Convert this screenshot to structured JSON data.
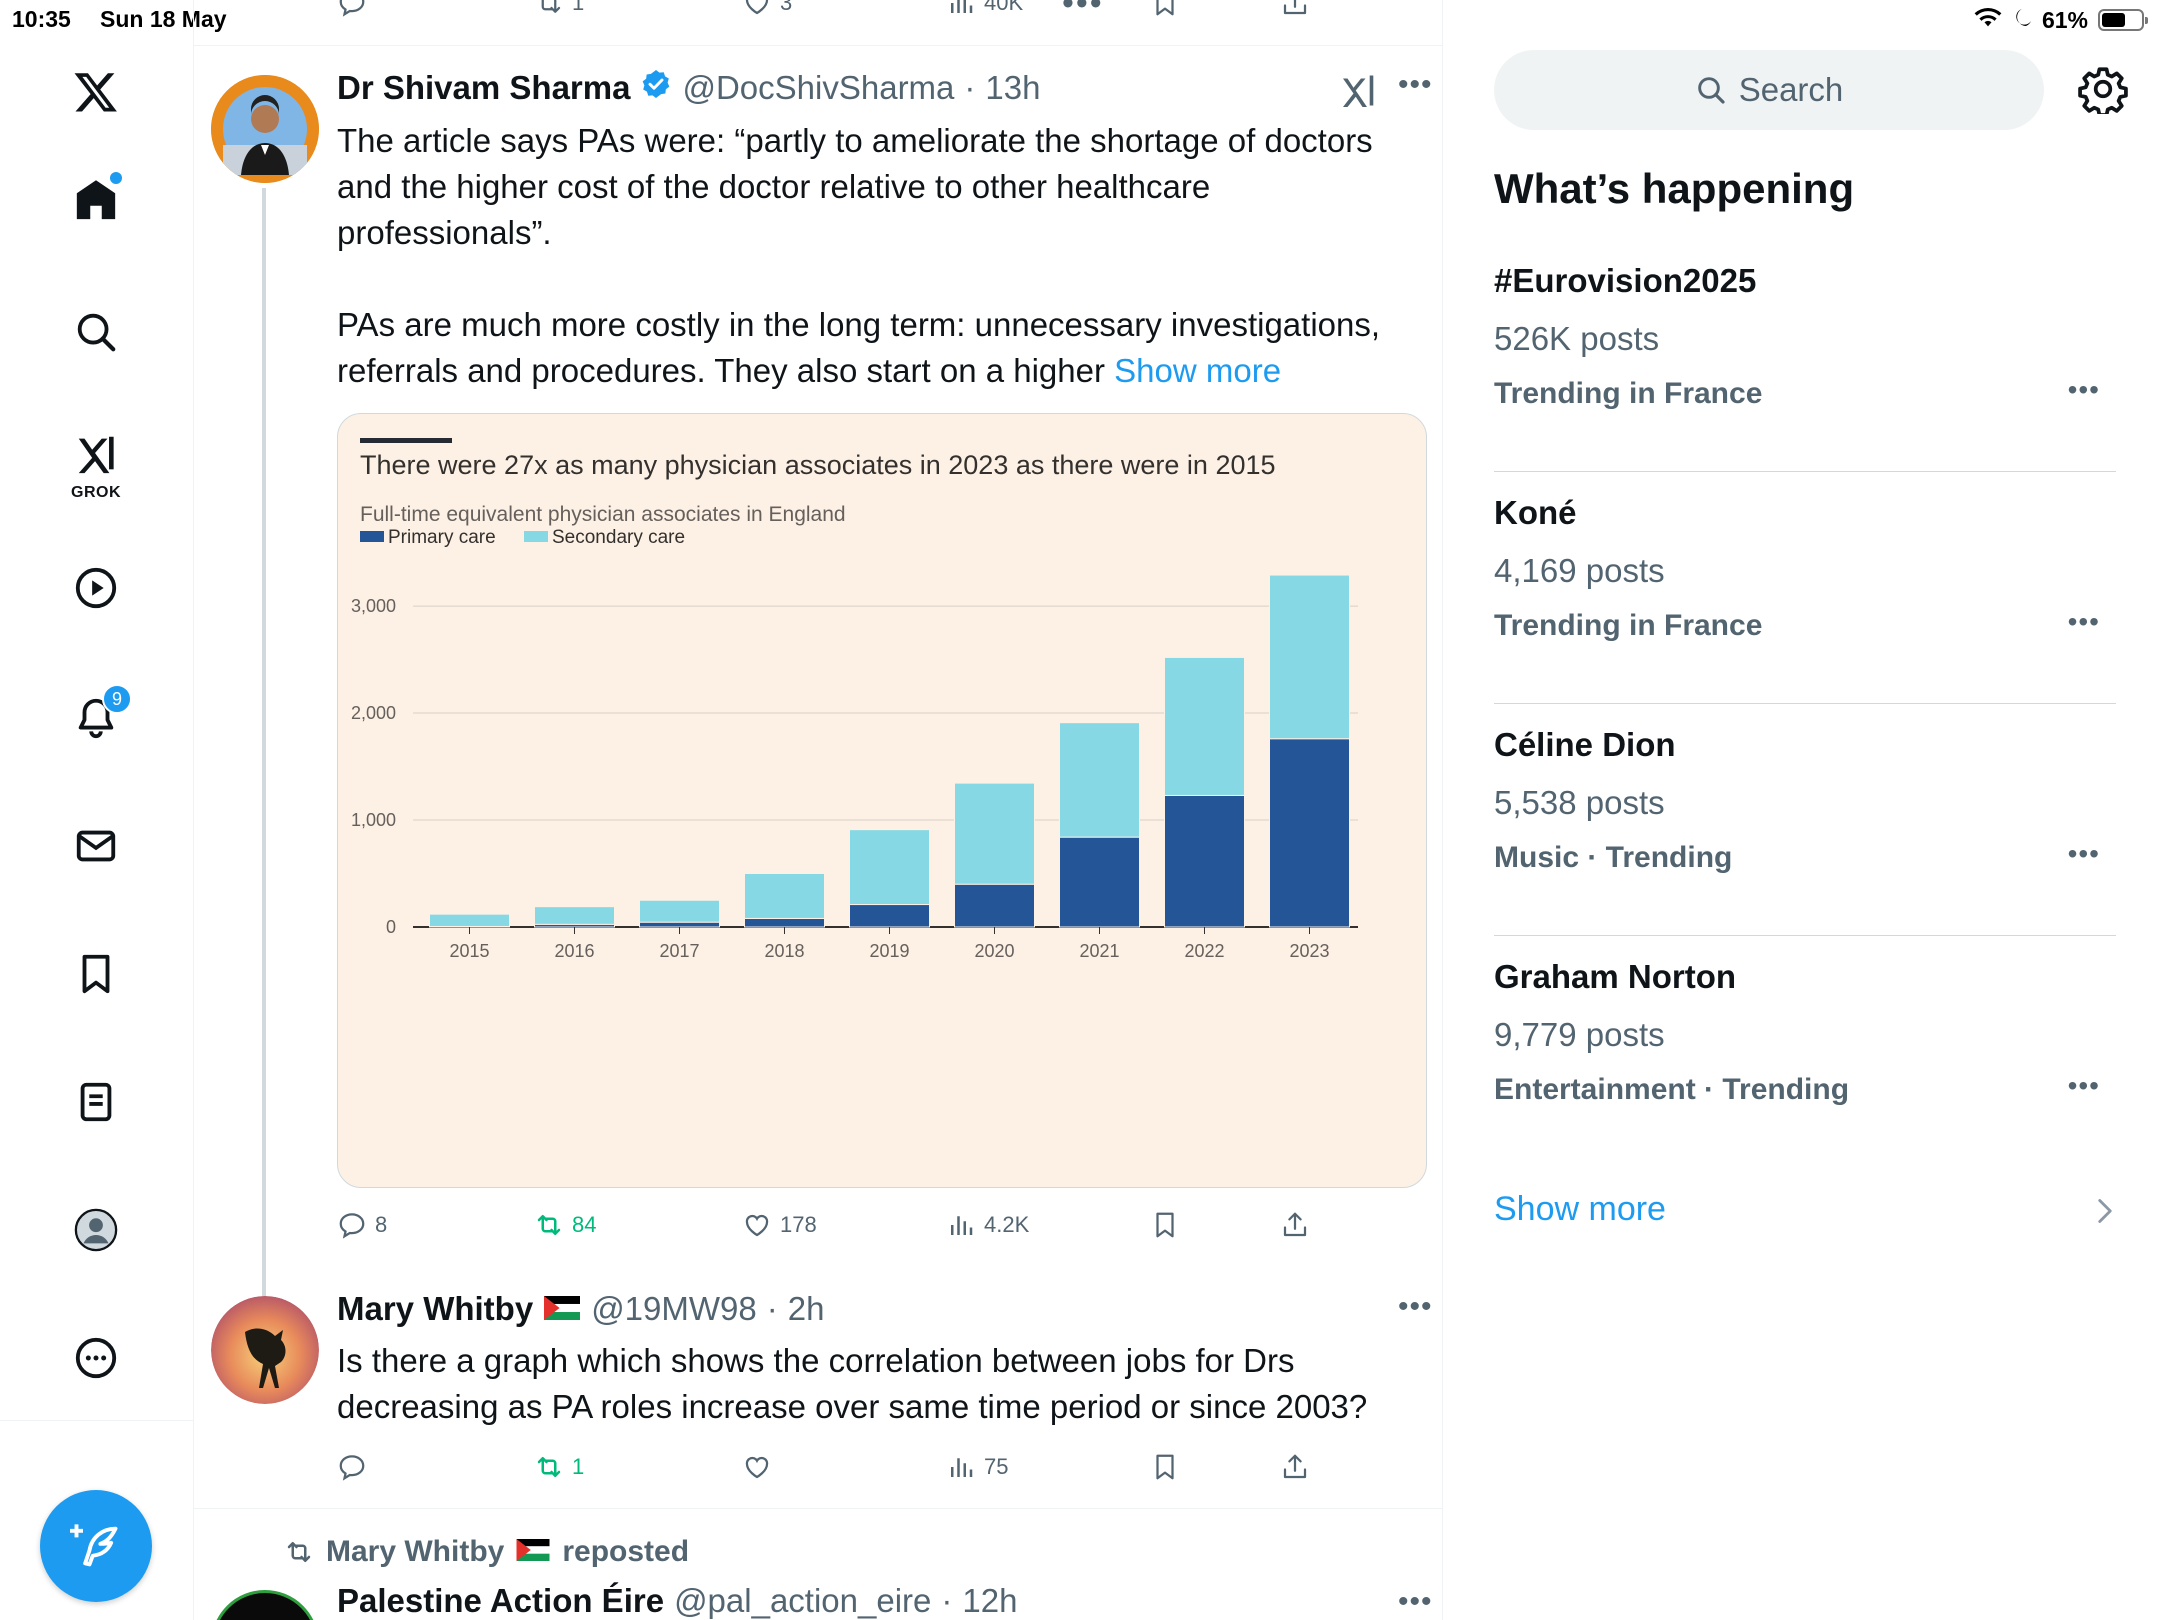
{
  "status": {
    "time": "10:35",
    "date": "Sun 18 May",
    "battery": "61%",
    "battery_level": 0.61
  },
  "nav": {
    "notifications_count": "9",
    "grok_label": "GROK",
    "items": [
      "x-logo-icon",
      "home-icon",
      "search-icon",
      "grok-icon",
      "video-icon",
      "bell-icon",
      "mail-icon",
      "bookmark-icon",
      "lists-icon",
      "profile-icon",
      "more-icon"
    ]
  },
  "prev_tweet_actions": {
    "retweets": "1",
    "likes": "3",
    "views": "40K"
  },
  "tweet1": {
    "name": "Dr Shivam Sharma",
    "handle": "@DocShivSharma",
    "time": "13h",
    "line1": "The article says PAs were: “partly to ameliorate the shortage of doctors",
    "line2": "and the higher cost of the doctor relative to other healthcare",
    "line3": "professionals”.",
    "line4": "PAs are much more costly in the long term: unnecessary investigations,",
    "line5": "referrals and procedures. They also start on a higher",
    "show_more": "Show more",
    "replies": "8",
    "retweets": "84",
    "likes": "178",
    "views": "4.2K"
  },
  "chart_data": {
    "type": "bar",
    "stacked": true,
    "title": "There were 27x as many physician associates in 2023 as there were in 2015",
    "subtitle": "Full-time equivalent physician associates in England",
    "categories": [
      "2015",
      "2016",
      "2017",
      "2018",
      "2019",
      "2020",
      "2021",
      "2022",
      "2023"
    ],
    "series": [
      {
        "name": "Primary care",
        "color": "#245597",
        "values": [
          5,
          25,
          45,
          80,
          210,
          400,
          840,
          1230,
          1760
        ]
      },
      {
        "name": "Secondary care",
        "color": "#86d8e4",
        "values": [
          115,
          165,
          205,
          420,
          700,
          945,
          1070,
          1290,
          1530
        ]
      }
    ],
    "yticks": [
      "0",
      "1,000",
      "2,000",
      "3,000"
    ],
    "ytick_values": [
      0,
      1000,
      2000,
      3000
    ],
    "ylim": [
      0,
      3300
    ],
    "grid": true,
    "legend": "top-left",
    "background": "#fdf1e5"
  },
  "tweet2": {
    "name": "Mary Whitby",
    "flag": "Palestine flag",
    "handle": "@19MW98",
    "time": "2h",
    "line1": "Is there a graph which shows the correlation between jobs for Drs",
    "line2": "decreasing as PA roles increase over same time period or since 2003?",
    "retweets": "1",
    "views": "75"
  },
  "tweet3": {
    "repost_by": "Mary Whitby",
    "repost_suffix": "reposted",
    "name": "Palestine Action Éire",
    "handle": "@pal_action_eire",
    "time": "12h"
  },
  "sidebar": {
    "search_placeholder": "Search",
    "title": "What’s happening",
    "trends": [
      {
        "name": "#Eurovision2025",
        "count": "526K posts",
        "context": "Trending in France"
      },
      {
        "name": "Koné",
        "count": "4,169 posts",
        "context": "Trending in France"
      },
      {
        "name": "Céline Dion",
        "count": "5,538 posts",
        "context": "Music · Trending"
      },
      {
        "name": "Graham Norton",
        "count": "9,779 posts",
        "context": "Entertainment · Trending"
      }
    ],
    "show_more": "Show more"
  },
  "colors": {
    "accent": "#1d9bf0",
    "retweet_green": "#00ba7c",
    "secondary_text": "#536471",
    "primary_care": "#245597",
    "secondary_care": "#86d8e4"
  }
}
